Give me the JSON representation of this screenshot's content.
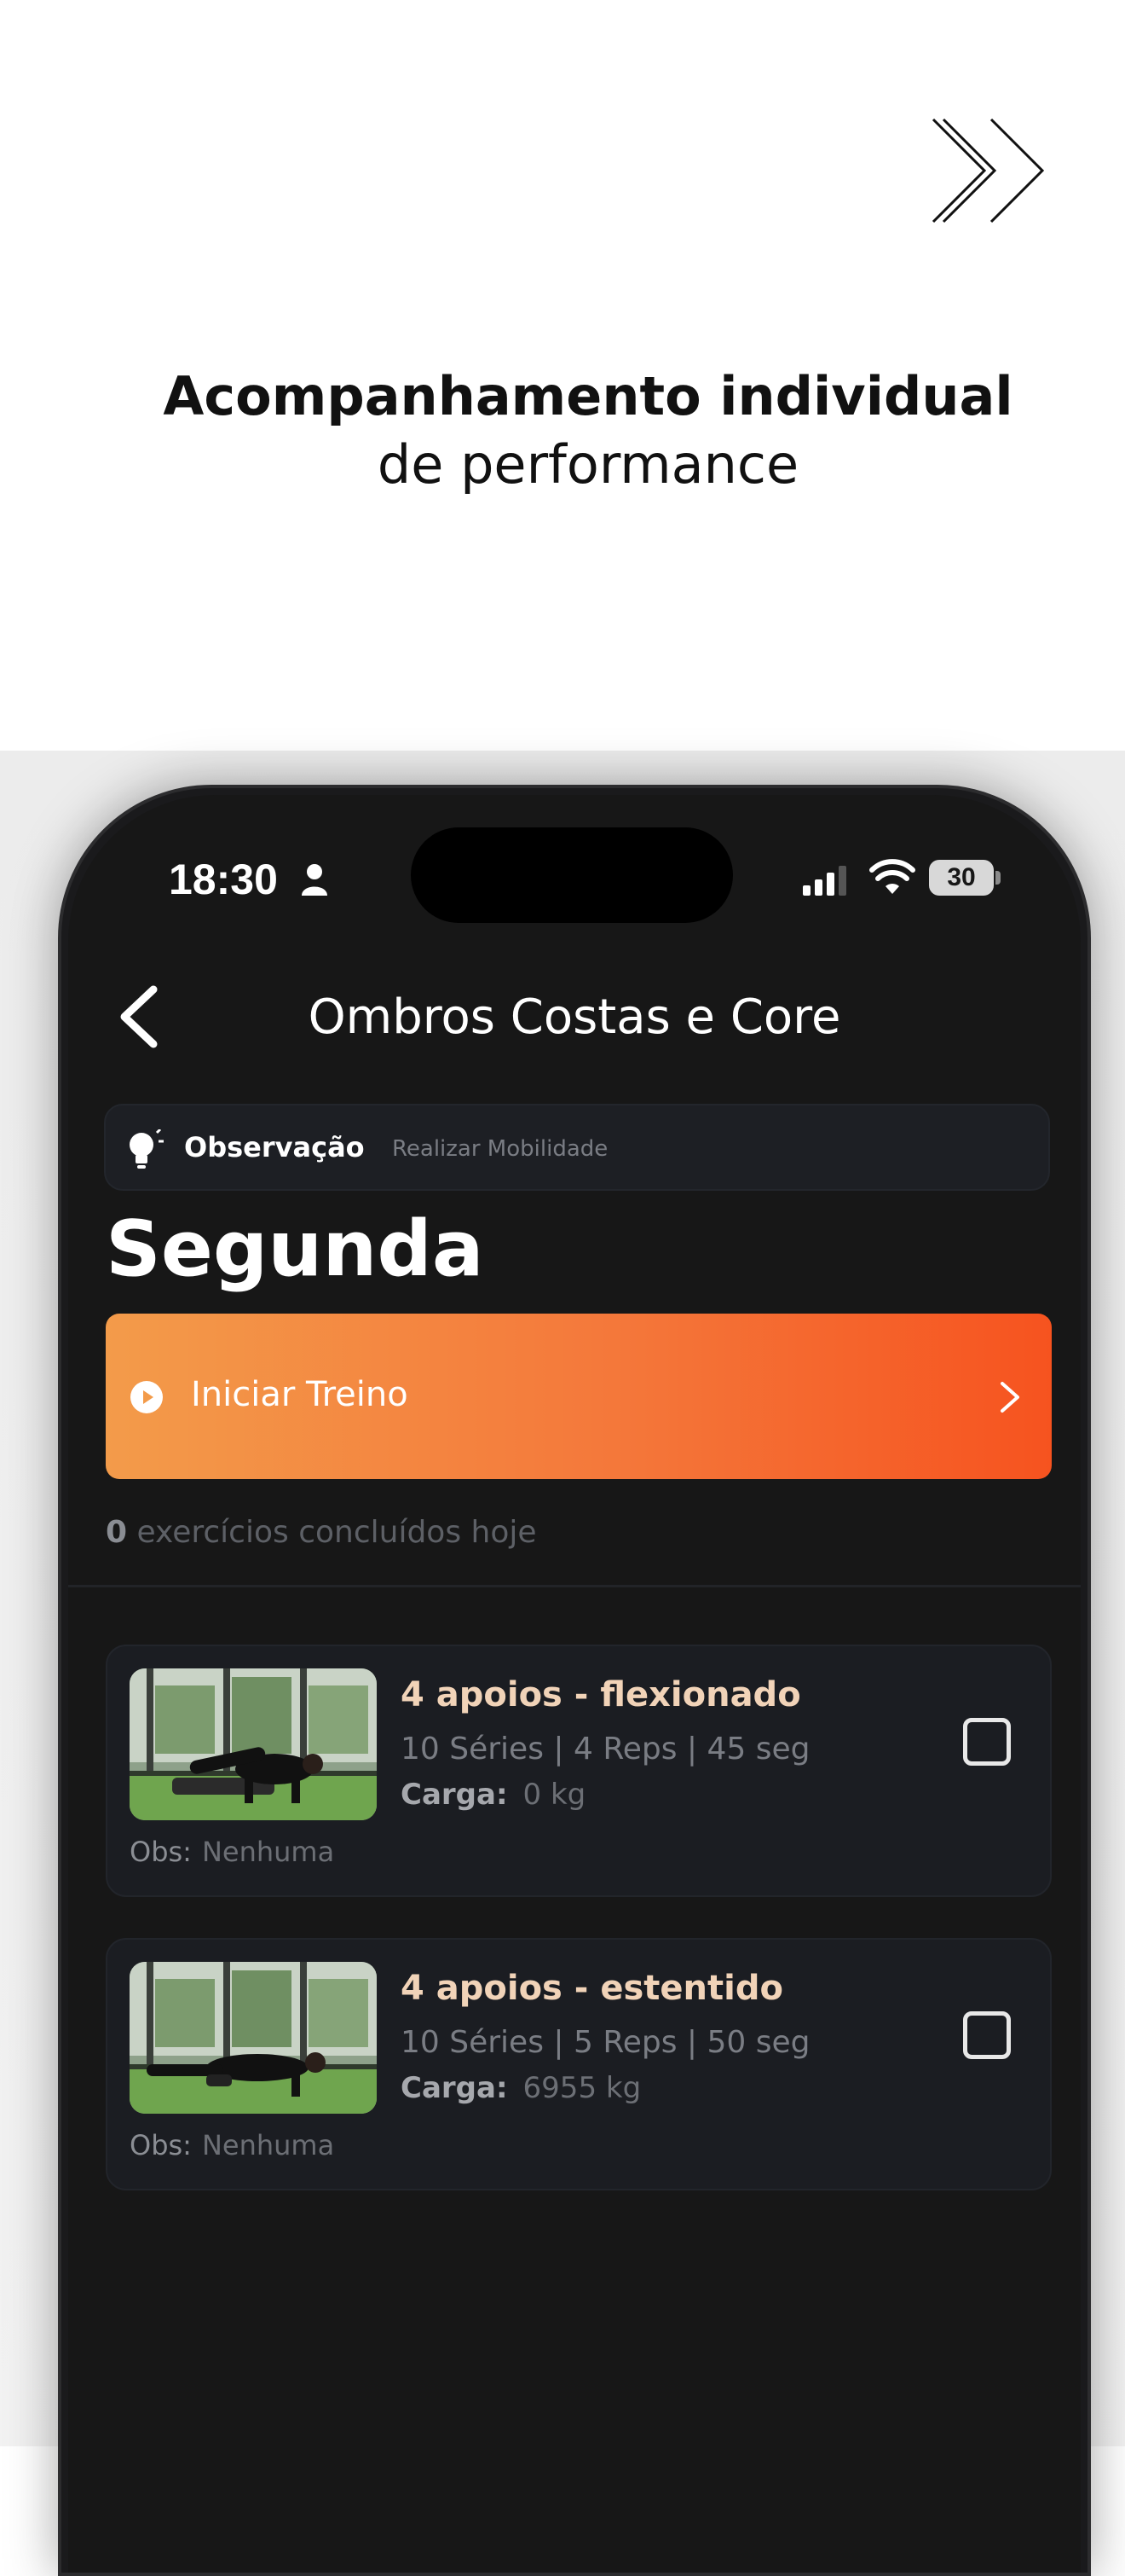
{
  "promo": {
    "headline_bold": "Acompanhamento individual",
    "headline_regular": "de performance",
    "icon": "double-chevron-right-icon"
  },
  "status_bar": {
    "time": "18:30",
    "battery": "30"
  },
  "nav": {
    "title": "Ombros Costas e Core"
  },
  "observation": {
    "label": "Observação",
    "text": "Realizar Mobilidade"
  },
  "day": "Segunda",
  "start_button": {
    "label": "Iniciar Treino"
  },
  "completed": {
    "count": "0",
    "text": "exercícios concluídos hoje"
  },
  "exercises": [
    {
      "name": "4 apoios - flexionado",
      "meta": "10 Séries | 4 Reps | 45 seg",
      "load_label": "Carga:",
      "load_value": "0 kg",
      "obs_label": "Obs:",
      "obs_value": "Nenhuma",
      "checked": false
    },
    {
      "name": "4 apoios - estentido",
      "meta": "10 Séries | 5 Reps | 50 seg",
      "load_label": "Carga:",
      "load_value": "6955 kg",
      "obs_label": "Obs:",
      "obs_value": "Nenhuma",
      "checked": false
    }
  ],
  "colors": {
    "accent_start": "#f39b4a",
    "accent_end": "#f6531f",
    "exercise_title": "#f1d3b8",
    "background": "#171717"
  }
}
